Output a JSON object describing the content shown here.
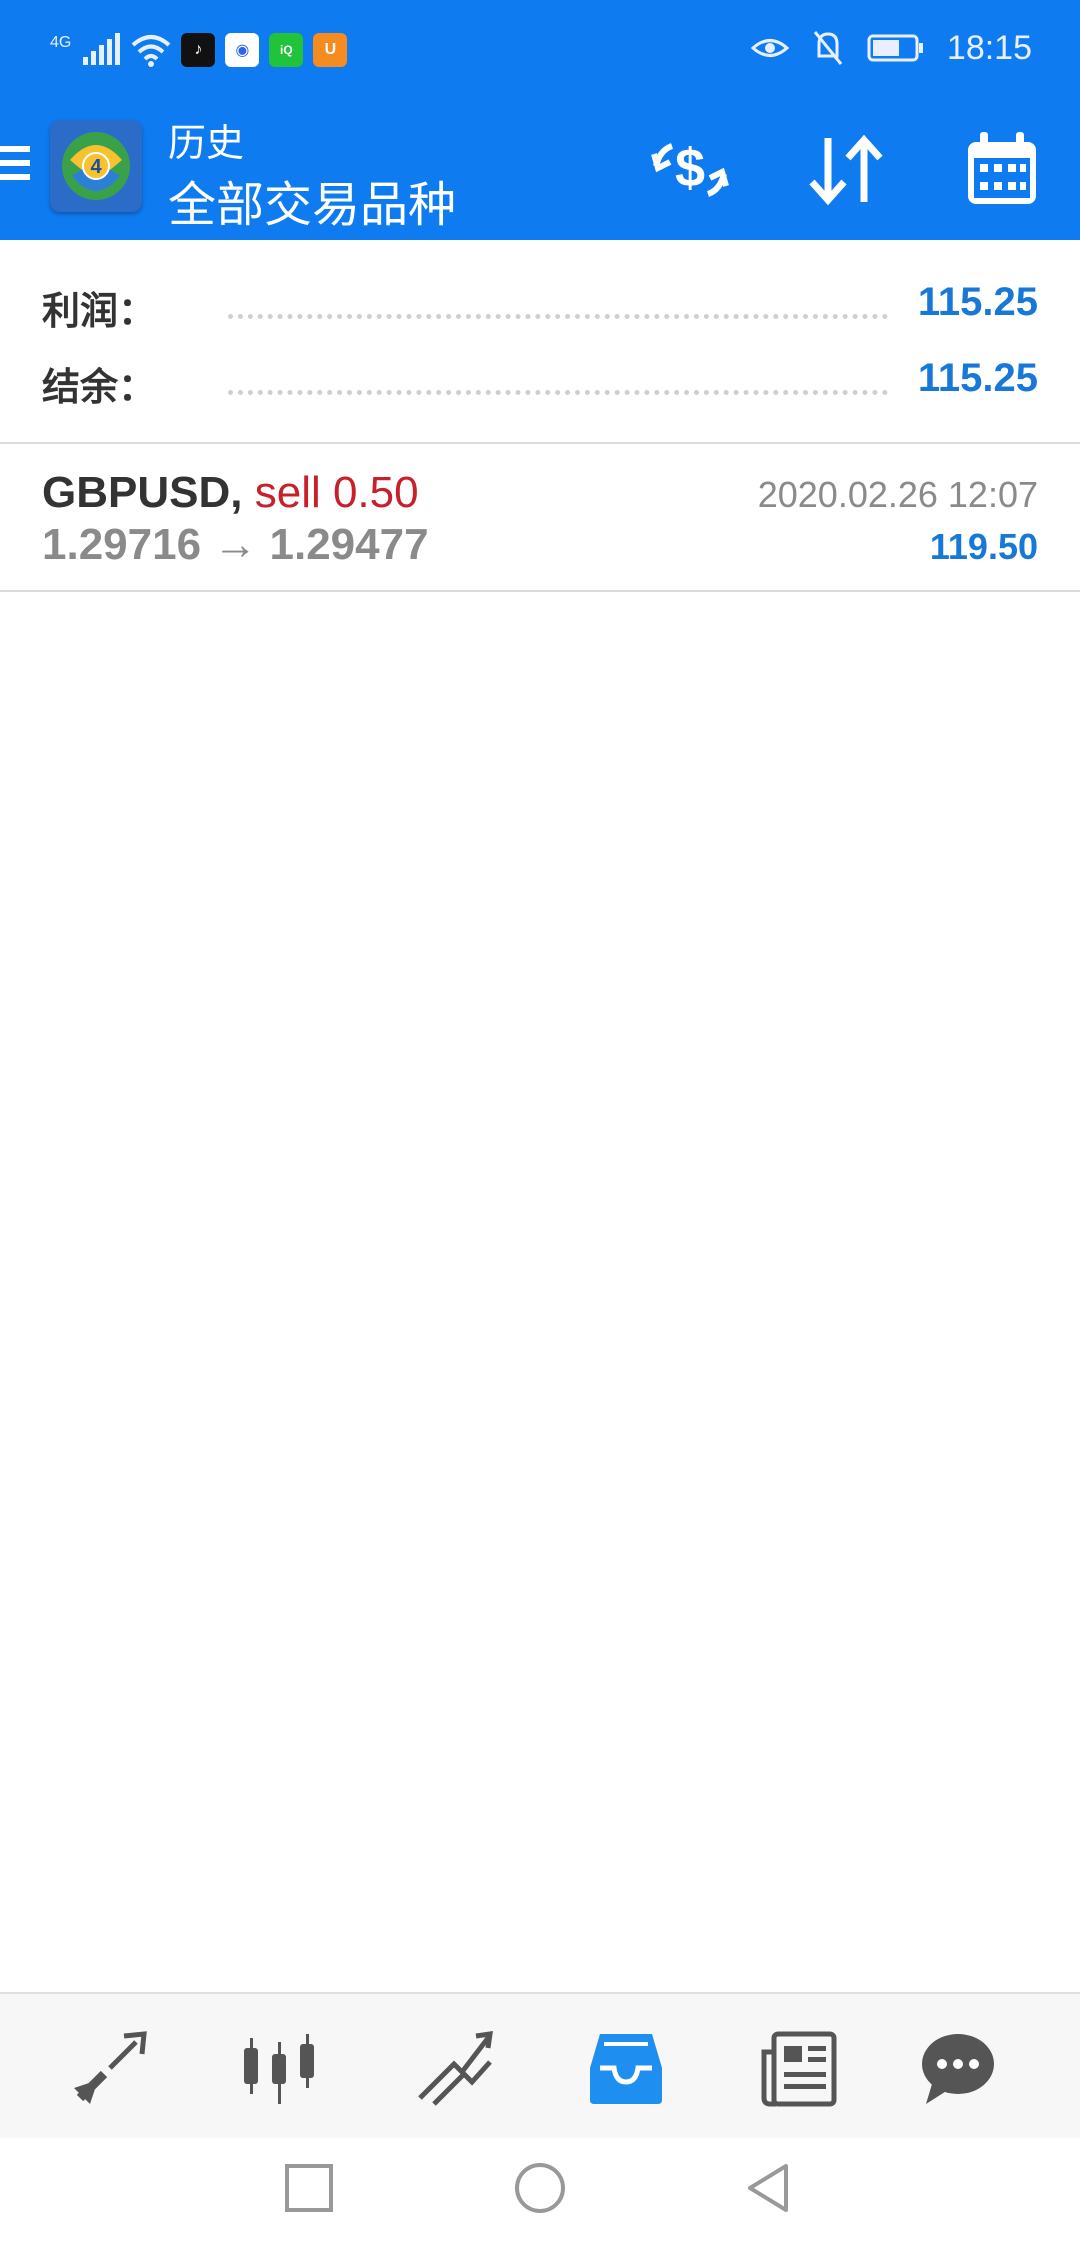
{
  "status_bar": {
    "network": "4G",
    "time": "18:15",
    "notification_icons": [
      "tiktok-icon",
      "baidu-icon",
      "iqiyi-icon",
      "uc-browser-icon"
    ]
  },
  "header": {
    "title": "历史",
    "subtitle": "全部交易品种",
    "accent_color": "#0f7bf1"
  },
  "summary": {
    "profit_label": "利润：",
    "profit_value": "115.25",
    "balance_label": "结余：",
    "balance_value": "115.25"
  },
  "deals": [
    {
      "symbol": "GBPUSD,",
      "type": "sell 0.50",
      "prices": "1.29716 → 1.29477",
      "time": "2020.02.26 12:07",
      "profit": "119.50"
    }
  ],
  "bottom_nav": {
    "items": [
      "trade-icon",
      "chart-icon",
      "quotes-icon",
      "history-icon",
      "news-icon",
      "chat-icon"
    ],
    "active": "history-icon",
    "active_color": "#1e8ff0"
  }
}
